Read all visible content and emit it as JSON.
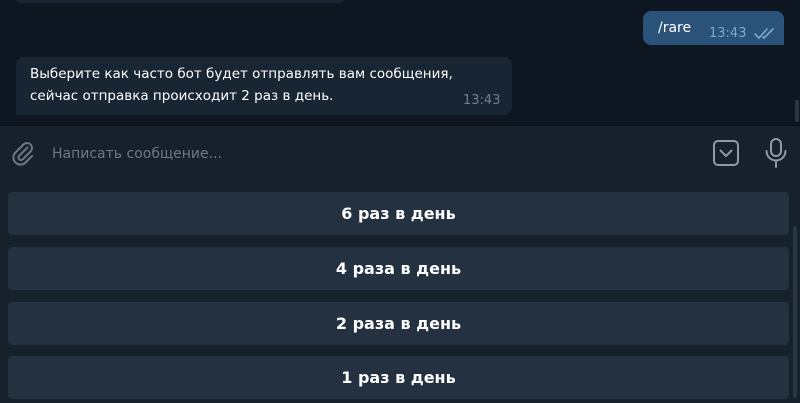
{
  "messages": {
    "outgoing": {
      "text": "/rare",
      "time": "13:43"
    },
    "incoming": {
      "line1": "Выберите как часто бот будет отправлять вам сообщения,",
      "line2": "сейчас отправка происходит 2 раз в день.",
      "time": "13:43"
    }
  },
  "composer": {
    "placeholder": "Написать сообщение..."
  },
  "bot_keyboard": {
    "buttons": [
      {
        "label": "6 раз в день"
      },
      {
        "label": "4 раза в день"
      },
      {
        "label": "2 раза в день"
      },
      {
        "label": "1 раз в день"
      }
    ]
  },
  "icons": {
    "attach": "paperclip-icon",
    "keyboard": "bot-keyboard-icon",
    "mic": "microphone-icon",
    "read_status": "double-check-icon"
  },
  "colors": {
    "background": "#0e1621",
    "outgoing_bubble": "#2b5278",
    "incoming_bubble": "#182533",
    "panel": "#17212b",
    "keyboard_button": "#243141",
    "accent": "#7da8d3"
  }
}
